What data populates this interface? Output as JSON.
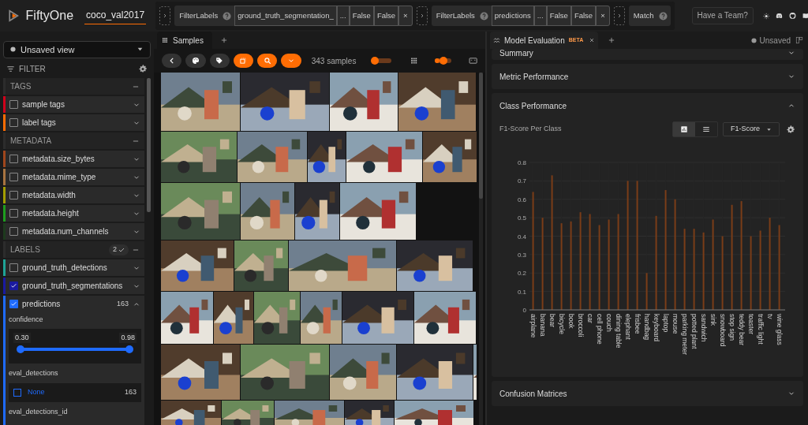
{
  "app": {
    "name": "FiftyOne",
    "dataset": "coco_val2017"
  },
  "view_bar": {
    "stages": [
      {
        "name": "FilterLabels",
        "params": [
          "ground_truth_segmentation_",
          "...",
          "False",
          "False"
        ],
        "close": "×"
      },
      {
        "name": "FilterLabels",
        "params": [
          "predictions",
          "...",
          "False",
          "False"
        ],
        "close": "×"
      },
      {
        "name": "Match"
      }
    ]
  },
  "header_button": "Have a Team?",
  "sidebar": {
    "view": "Unsaved view",
    "filter_label": "FILTER",
    "groups": [
      {
        "title": "TAGS",
        "items": [
          {
            "label": "sample tags",
            "color": "#d0021b",
            "checked": false
          },
          {
            "label": "label tags",
            "color": "#ff6d04",
            "checked": false
          }
        ]
      },
      {
        "title": "METADATA",
        "items": [
          {
            "label": "metadata.size_bytes",
            "color": "#a0461c",
            "checked": false
          },
          {
            "label": "metadata.mime_type",
            "color": "#a87440",
            "checked": false
          },
          {
            "label": "metadata.width",
            "color": "#a39e00",
            "checked": false
          },
          {
            "label": "metadata.height",
            "color": "#1f9e1f",
            "checked": false
          },
          {
            "label": "metadata.num_channels",
            "color": "#1e3a1e",
            "checked": false
          }
        ]
      },
      {
        "title": "LABELS",
        "badge": "2",
        "items": [
          {
            "label": "ground_truth_detections",
            "color": "#1fa396",
            "checked": false
          },
          {
            "label": "ground_truth_segmentations",
            "color": "#1a1aa0",
            "checked": true
          },
          {
            "label": "predictions",
            "color": "#1f6bff",
            "checked": true,
            "expanded": true,
            "count": "163",
            "filters": {
              "confidence": {
                "label": "confidence",
                "min": "0.30",
                "max": "0.98",
                "level": 1
              },
              "eval": {
                "label": "eval_detections",
                "option": "None",
                "count": "163",
                "checked": false
              },
              "next_label": "eval_detections_id"
            }
          }
        ]
      }
    ]
  },
  "samples_panel": {
    "tab": "Samples",
    "count": "343 samples",
    "zoom_slider": {
      "level": 0.15
    },
    "size_slider": {
      "level": 0.55
    }
  },
  "evaluation_panel": {
    "tab": "Model Evaluation",
    "tab_badge": "BETA",
    "status": "Unsaved",
    "sections": [
      {
        "title": "Summary",
        "expanded": false
      },
      {
        "title": "Metric Performance",
        "expanded": false
      },
      {
        "title": "Class Performance",
        "expanded": true
      },
      {
        "title": "Confusion Matrices",
        "expanded": false
      }
    ],
    "class_performance": {
      "metric": "F1-Score",
      "views": [
        {
          "kind": "bar",
          "selected": true
        },
        {
          "kind": "table",
          "selected": false
        }
      ],
      "chart_data": {
        "type": "bar",
        "title": "F1-Score Per Class",
        "categories": [
          "airplane",
          "banana",
          "bear",
          "bicycle",
          "book",
          "broccoli",
          "car",
          "cell phone",
          "couch",
          "dining table",
          "elephant",
          "frisbee",
          "handbag",
          "keyboard",
          "laptop",
          "mouse",
          "parking meter",
          "potted plant",
          "sandwich",
          "sink",
          "snowboard",
          "stop sign",
          "teddy bear",
          "toaster",
          "traffic light",
          "tv",
          "wine glass"
        ],
        "values": [
          0.64,
          0.5,
          0.73,
          0.47,
          0.48,
          0.53,
          0.52,
          0.46,
          0.49,
          0.52,
          0.7,
          0.7,
          0.2,
          0.51,
          0.65,
          0.6,
          0.44,
          0.44,
          0.42,
          0.49,
          0.4,
          0.57,
          0.59,
          0.4,
          0.43,
          0.5,
          0.46
        ],
        "ylim": [
          0,
          0.8
        ],
        "yticks": [
          0,
          0.1,
          0.2,
          0.3,
          0.4,
          0.5,
          0.6,
          0.7,
          0.8
        ],
        "grid": true
      }
    }
  }
}
